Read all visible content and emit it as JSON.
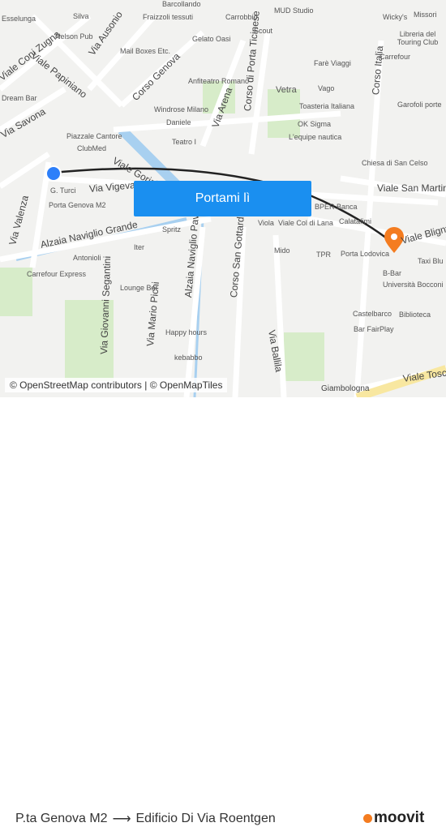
{
  "map": {
    "streets": [
      "Viale Coni Zugna",
      "Viale Papiniano",
      "Via Savona",
      "Via Ausonio",
      "Corso Genova",
      "Via Arena",
      "Corso di Porta Ticinese",
      "Corso Italia",
      "Via Vigevano",
      "Alzaia Naviglio Grande",
      "Alzaia Naviglio Pavese",
      "Corso San Gottardo",
      "Via Mario Pichi",
      "Via Giovanni Segantini",
      "Via Ballila",
      "Viale San Martino",
      "Viale Bligny",
      "Via Valenza",
      "Viale Toscana",
      "Viale Gorizia",
      "Viale Col di Lana"
    ],
    "pois": [
      "Silva",
      "Esselunga",
      "Nelson Pub",
      "Fraizzoli tessuti",
      "Barcollando",
      "Carrobbio",
      "MUD Studio",
      "Wicky's",
      "Missori",
      "Libreria del Touring Club",
      "Carrefour",
      "Mail Boxes Etc.",
      "Gelato Oasi",
      "Scout",
      "Farè Viaggi",
      "Vago",
      "Garofoli porte",
      "Anfiteatro Romano",
      "Vetra",
      "Toasteria Italiana",
      "Dream Bar",
      "Windrose Milano",
      "Daniele",
      "OK Sigma",
      "L'equipe nautica",
      "Piazzale Cantore",
      "ClubMed",
      "Teatro I",
      "Chiesa di San Celso",
      "G. Turci",
      "Porta Genova M2",
      "BPER Banca",
      "Calatafimi",
      "Viola",
      "Mido",
      "TPR",
      "Porta Lodovica",
      "B-Bar",
      "Università Bocconi",
      "Spritz",
      "Iter",
      "Antonioli",
      "Carrefour Express",
      "Lounge Bar",
      "Happy hours",
      "kebabbo",
      "Castelbarco",
      "Biblioteca",
      "Bar FairPlay",
      "Giambologna",
      "Taxi Blu"
    ]
  },
  "cta_label": "Portami lì",
  "attribution": "© OpenStreetMap contributors | © OpenMapTiles",
  "route": {
    "from": "P.ta Genova M2",
    "arrow": "⟶",
    "to": "Edificio Di Via Roentgen"
  },
  "brand": "moovit",
  "colors": {
    "accent": "#1a8ff0",
    "brand": "#f47c20",
    "origin": "#2d7ff9"
  }
}
